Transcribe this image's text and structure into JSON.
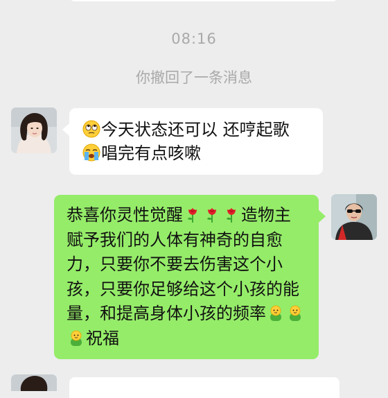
{
  "chat": {
    "timestamp": "08:16",
    "recall_notice": "你撤回了一条消息",
    "incoming_message": {
      "part1": "今天状态还可以 还哼起歌",
      "part2": "唱完有点咳嗽",
      "emoji1": "rolling-eyes-emoji",
      "emoji2": "crying-face-emoji"
    },
    "outgoing_message": {
      "part1": "恭喜你灵性觉醒",
      "part2": "造物主赋予我们的人体有神奇的自愈力，只要你不要去伤害这个小孩，只要你足够给这个小孩的能量，和提高身体小孩的频率",
      "part3": "祝福",
      "rose_emoji": "rose-emoji",
      "baby_emoji": "baby-emoji"
    }
  },
  "colors": {
    "background": "#ededed",
    "incoming_bubble": "#ffffff",
    "outgoing_bubble": "#95ec69",
    "meta_text": "#a9a9a9"
  }
}
